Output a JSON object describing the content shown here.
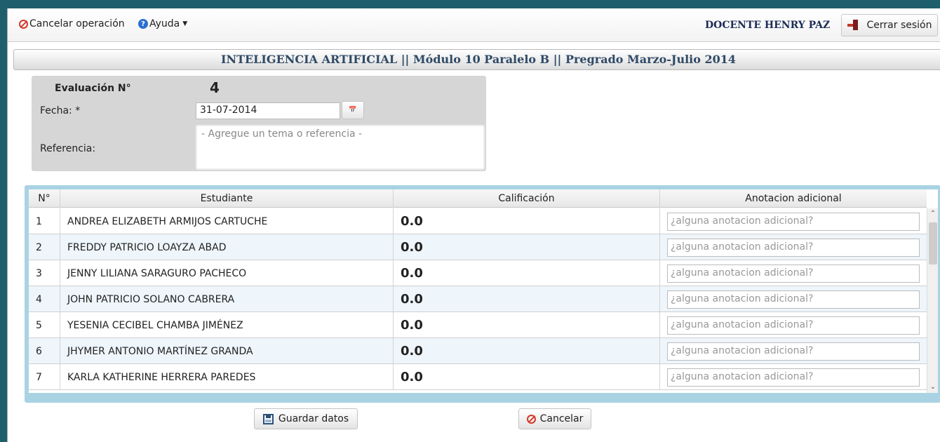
{
  "toolbar": {
    "cancel_label": "Cancelar operación",
    "help_label": "Ayuda",
    "user_label": "DOCENTE HENRY PAZ",
    "logout_label": "Cerrar sesión"
  },
  "header": {
    "title": "INTELIGENCIA ARTIFICIAL || Módulo 10 Paralelo B || Pregrado Marzo-Julio 2014"
  },
  "form": {
    "eval_label": "Evaluación N°",
    "eval_number": "4",
    "date_label": "Fecha:  *",
    "date_value": "31-07-2014",
    "reference_label": "Referencia:",
    "reference_placeholder": "- Agregue un tema o referencia -"
  },
  "grid": {
    "columns": [
      "N°",
      "Estudiante",
      "Calificación",
      "Anotacion adicional"
    ],
    "note_placeholder": "¿alguna anotacion adicional?",
    "rows": [
      {
        "no": "1",
        "name": "ANDREA ELIZABETH ARMIJOS CARTUCHE",
        "grade": "0.0"
      },
      {
        "no": "2",
        "name": "FREDDY PATRICIO LOAYZA ABAD",
        "grade": "0.0"
      },
      {
        "no": "3",
        "name": "JENNY LILIANA SARAGURO PACHECO",
        "grade": "0.0"
      },
      {
        "no": "4",
        "name": "JOHN PATRICIO SOLANO CABRERA",
        "grade": "0.0"
      },
      {
        "no": "5",
        "name": "YESENIA CECIBEL CHAMBA JIMÉNEZ",
        "grade": "0.0"
      },
      {
        "no": "6",
        "name": "JHYMER ANTONIO MARTÍNEZ GRANDA",
        "grade": "0.0"
      },
      {
        "no": "7",
        "name": "KARLA KATHERINE HERRERA PAREDES",
        "grade": "0.0"
      }
    ]
  },
  "actions": {
    "save_label": "Guardar datos",
    "cancel_label": "Cancelar"
  }
}
